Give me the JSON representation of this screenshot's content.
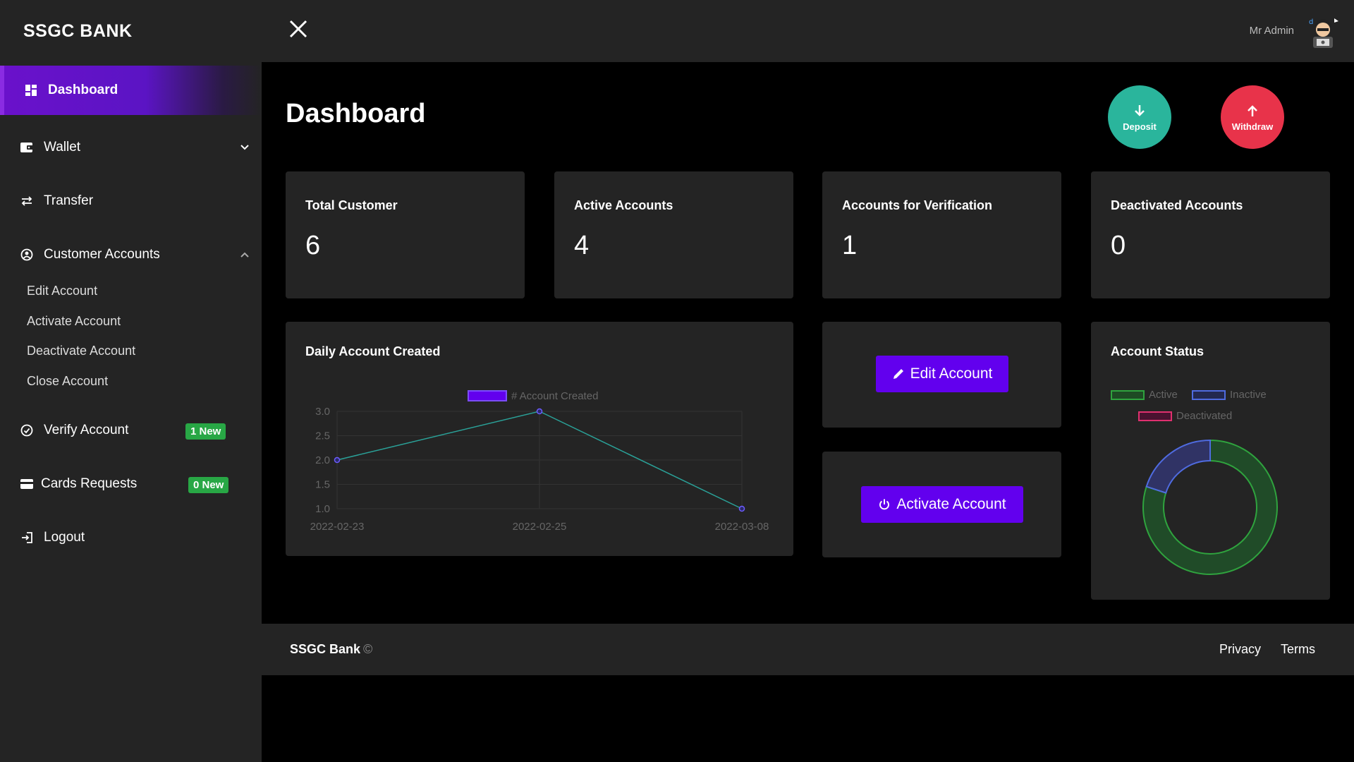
{
  "brand": "SSGC BANK",
  "topbar": {
    "admin_name": "Mr Admin"
  },
  "sidebar": {
    "dashboard": "Dashboard",
    "wallet": "Wallet",
    "transfer": "Transfer",
    "customer_accounts": "Customer Accounts",
    "sub_items": [
      "Edit Account",
      "Activate Account",
      "Deactivate Account",
      "Close Account"
    ],
    "verify_account": "Verify Account",
    "verify_badge": "1 New",
    "cards_requests": "Cards Requests",
    "cards_badge": "0 New",
    "logout": "Logout"
  },
  "main": {
    "title": "Dashboard",
    "deposit": "Deposit",
    "withdraw": "Withdraw",
    "stats": [
      {
        "label": "Total Customer",
        "value": "6"
      },
      {
        "label": "Active Accounts",
        "value": "4"
      },
      {
        "label": "Accounts for Verification",
        "value": "1"
      },
      {
        "label": "Deactivated Accounts",
        "value": "0"
      }
    ],
    "edit_account_btn": "Edit Account",
    "activate_account_btn": "Activate Account"
  },
  "chart_data": [
    {
      "type": "line",
      "title": "Daily Account Created",
      "x": [
        "2022-02-23",
        "2022-02-25",
        "2022-03-08"
      ],
      "series": [
        {
          "name": "# Account Created",
          "values": [
            2,
            3,
            1
          ]
        }
      ],
      "yticks": [
        "1.0",
        "1.5",
        "2.0",
        "2.5",
        "3.0"
      ],
      "ylim": [
        1,
        3
      ],
      "grid": true,
      "legend": "top",
      "colors": {
        "line": "#2aa198",
        "point": "#6d5cff",
        "legend": "#6200ee"
      }
    },
    {
      "type": "pie",
      "title": "Account Status",
      "categories": [
        "Active",
        "Inactive",
        "Deactivated"
      ],
      "values": [
        4,
        1,
        0
      ],
      "legend": "top",
      "colors": [
        "#1e6b2b",
        "#3a3f9a",
        "#9b1b5a"
      ],
      "border_colors": [
        "#2fa33e",
        "#4f6be0",
        "#e0306f"
      ]
    }
  ],
  "footer": {
    "brand": "SSGC Bank",
    "copy": "©",
    "privacy": "Privacy",
    "terms": "Terms"
  }
}
